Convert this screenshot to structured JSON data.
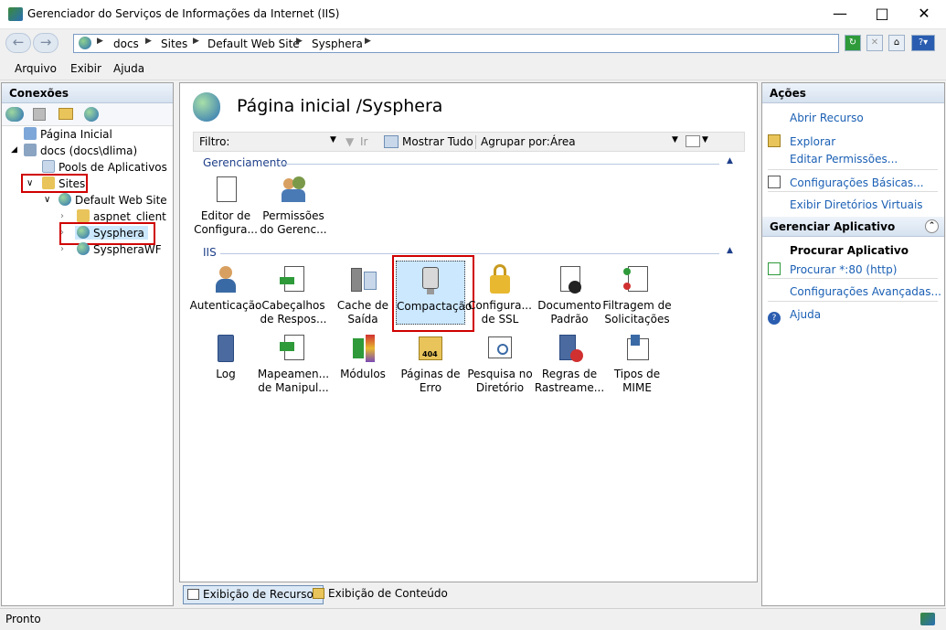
{
  "window": {
    "title": "Gerenciador do Serviços de Informações da Internet (IIS)"
  },
  "breadcrumb": [
    "docs",
    "Sites",
    "Default Web Site",
    "Sysphera"
  ],
  "menu": [
    "Arquivo",
    "Exibir",
    "Ajuda"
  ],
  "connections": {
    "title": "Conexões",
    "tree": [
      {
        "label": "Página Inicial"
      },
      {
        "label": "docs (docs\\dlima)"
      },
      {
        "label": "Pools de Aplicativos"
      },
      {
        "label": "Sites"
      },
      {
        "label": "Default Web Site"
      },
      {
        "label": "aspnet_client"
      },
      {
        "label": "Sysphera"
      },
      {
        "label": "SyspheraWF"
      }
    ]
  },
  "center": {
    "title": "Página inicial /Sysphera",
    "filter_label": "Filtro:",
    "go_label": "Ir",
    "show_all_label": "Mostrar Tudo",
    "group_by_label": "Agrupar por:",
    "group_by_value": "Área",
    "groups": [
      {
        "name": "Gerenciamento",
        "features": [
          {
            "label": "Editor de Configura...",
            "icon": "config-editor-icon"
          },
          {
            "label": "Permissões do Gerenc...",
            "icon": "permissions-icon"
          }
        ]
      },
      {
        "name": "IIS",
        "features": [
          {
            "label": "Autenticação",
            "icon": "authentication-icon"
          },
          {
            "label": "Cabeçalhos de Respos...",
            "icon": "response-headers-icon"
          },
          {
            "label": "Cache de Saída",
            "icon": "output-cache-icon"
          },
          {
            "label": "Compactação",
            "icon": "compression-icon"
          },
          {
            "label": "Configura... de SSL",
            "icon": "ssl-lock-icon"
          },
          {
            "label": "Documento Padrão",
            "icon": "default-document-icon"
          },
          {
            "label": "Filtragem de Solicitações",
            "icon": "request-filtering-icon"
          },
          {
            "label": "Log",
            "icon": "log-icon"
          },
          {
            "label": "Mapeamen... de Manipul...",
            "icon": "handler-mappings-icon"
          },
          {
            "label": "Módulos",
            "icon": "modules-icon"
          },
          {
            "label": "Páginas de Erro",
            "icon": "error-pages-icon"
          },
          {
            "label": "Pesquisa no Diretório",
            "icon": "directory-browsing-icon"
          },
          {
            "label": "Regras de Rastreame...",
            "icon": "failed-request-tracing-icon"
          },
          {
            "label": "Tipos de MIME",
            "icon": "mime-types-icon"
          }
        ]
      }
    ],
    "error_pages_badge": "404",
    "view_tabs": [
      "Exibição de Recursos",
      "Exibição de Conteúdo"
    ]
  },
  "actions": {
    "title": "Ações",
    "items": [
      "Abrir Recurso",
      "Explorar",
      "Editar Permissões...",
      "Configurações Básicas...",
      "Exibir Diretórios Virtuais"
    ],
    "manage_title": "Gerenciar Aplicativo",
    "browse_title": "Procurar Aplicativo",
    "browse_link": "Procurar *:80 (http)",
    "advanced": "Configurações Avançadas...",
    "help": "Ajuda"
  },
  "status": {
    "text": "Pronto"
  },
  "colors": {
    "link": "#1a5fb4",
    "highlight": "#d00000",
    "selection": "#cce8ff"
  }
}
